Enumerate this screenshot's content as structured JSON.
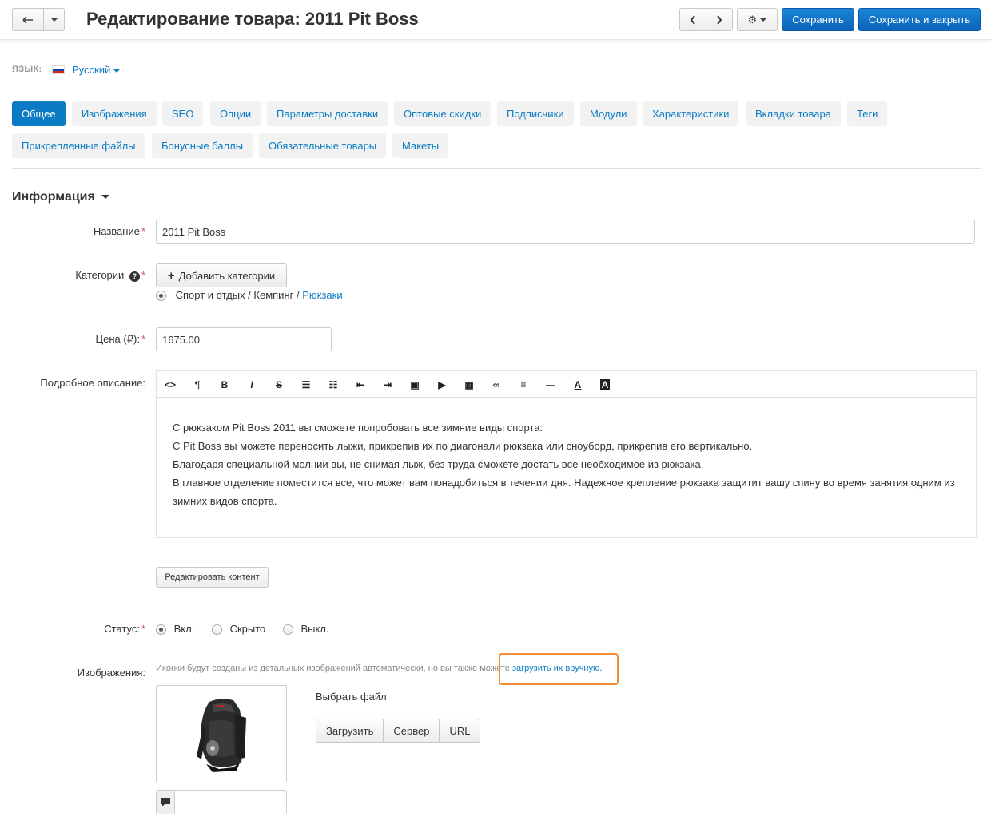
{
  "header": {
    "title": "Редактирование товара: 2011 Pit Boss",
    "save_label": "Сохранить",
    "save_close_label": "Сохранить и закрыть"
  },
  "language": {
    "label": "ЯЗЫК:",
    "current": "Русский"
  },
  "tabs": [
    {
      "label": "Общее",
      "active": true
    },
    {
      "label": "Изображения"
    },
    {
      "label": "SEO"
    },
    {
      "label": "Опции"
    },
    {
      "label": "Параметры доставки"
    },
    {
      "label": "Оптовые скидки"
    },
    {
      "label": "Подписчики"
    },
    {
      "label": "Модули"
    },
    {
      "label": "Характеристики"
    },
    {
      "label": "Вкладки товара"
    },
    {
      "label": "Теги"
    },
    {
      "label": "Прикрепленные файлы"
    },
    {
      "label": "Бонусные баллы"
    },
    {
      "label": "Обязательные товары"
    },
    {
      "label": "Макеты"
    }
  ],
  "section": {
    "title": "Информация"
  },
  "form": {
    "name_label": "Название",
    "name_value": "2011 Pit Boss",
    "categories_label": "Категории",
    "add_categories_label": "Добавить категории",
    "category_path": "Спорт и отдых / Кемпинг / ",
    "category_leaf": "Рюкзаки",
    "price_label": "Цена (₽):",
    "price_value": "1675.00",
    "description_label": "Подробное описание:",
    "description_lines": [
      "С рюкзаком Pit Boss 2011 вы сможете попробовать все зимние виды спорта:",
      "С Pit Boss вы можете переносить лыжи, прикрепив их по диагонали рюкзака или сноуборд, прикрепив его вертикально.",
      "Благодаря специальной молнии вы, не снимая лыж, без труда сможете достать все необходимое из рюкзака.",
      "В главное отделение поместится все, что может вам понадобиться в течении дня. Надежное крепление рюкзака защитит вашу спину во время занятия одним из",
      "зимних видов спорта."
    ],
    "edit_content_label": "Редактировать контент",
    "status_label": "Статус:",
    "status_options": [
      "Вкл.",
      "Скрыто",
      "Выкл."
    ],
    "status_selected": "Вкл.",
    "images_label": "Изображения:",
    "images_hint": "Иконки будут созданы из детальных изображений автоматически, но вы также можете ",
    "images_hint_link": "загрузить их вручную.",
    "choose_file_label": "Выбрать файл",
    "upload_buttons": [
      "Загрузить",
      "Сервер",
      "URL"
    ]
  },
  "colors": {
    "accent": "#0b7cc4",
    "highlight": "#f08c36",
    "required": "#d9534f"
  }
}
